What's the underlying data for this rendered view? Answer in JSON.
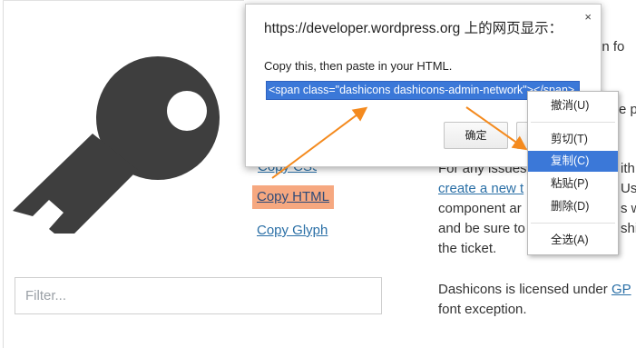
{
  "dialog": {
    "title": "https://developer.wordpress.org 上的网页显示：",
    "close_glyph": "×",
    "message": "Copy this, then paste in your HTML.",
    "input_value": "<span class=\"dashicons dashicons-admin-network\"></span>",
    "ok_label": "确定"
  },
  "icon_panel": {
    "copy_html_label": "Copy HTML",
    "copy_glyph_label": "Copy Glyph",
    "copy_css_label": "Copy CSS",
    "filter_placeholder": "Filter..."
  },
  "sidebar_text": {
    "line_1_tail": "on fo",
    "line_3_tail": "e p",
    "issues_line": "For any issues",
    "issues_with": "ith",
    "create_link": "create a new t",
    "use_tail": "Use",
    "component_line": "component ar",
    "s_w": "s w",
    "sure_line": "and be sure to",
    "shico": "shico",
    "ticket_line": "the ticket.",
    "license_line": "Dashicons is licensed under ",
    "gpl_link": "GP",
    "font_exception": "font exception."
  },
  "context_menu": {
    "items": [
      {
        "label": "撤消(U)",
        "active": false
      },
      {
        "label": "剪切(T)",
        "active": false
      },
      {
        "label": "复制(C)",
        "active": true
      },
      {
        "label": "粘贴(P)",
        "active": false
      },
      {
        "label": "删除(D)",
        "active": false
      },
      {
        "label": "全选(A)",
        "active": false
      }
    ]
  },
  "colors": {
    "accent_orange": "#f48a1e",
    "highlight_bg": "#f6a880",
    "selection_blue": "#3b78d8",
    "key_gray": "#3e3e3e"
  }
}
